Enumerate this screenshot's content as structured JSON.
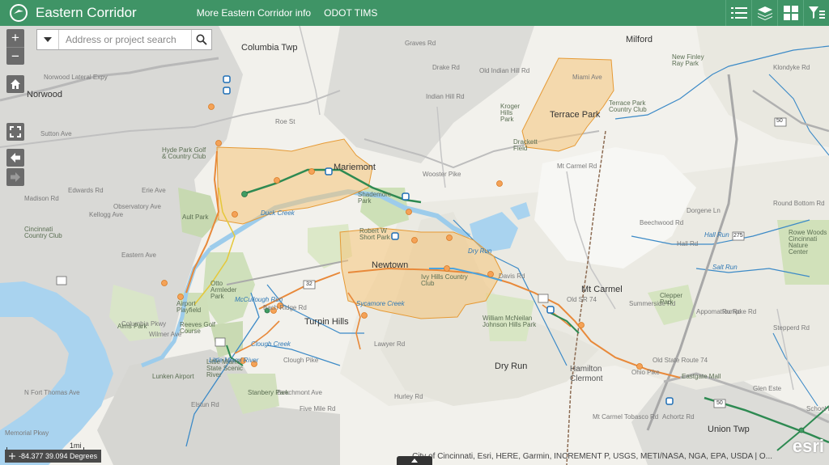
{
  "header": {
    "title": "Eastern Corridor",
    "links": [
      "More Eastern Corridor info",
      "ODOT TIMS"
    ],
    "icons": [
      "list-icon",
      "layers-icon",
      "basemap-gallery-icon",
      "filter-icon"
    ],
    "color": "#3f9466"
  },
  "search": {
    "placeholder": "Address or project search"
  },
  "controls": {
    "zoom_in": "+",
    "zoom_out": "−"
  },
  "coordinates": "-84.377 39.094 Degrees",
  "scale_label": "1mi",
  "attribution": "City of Cincinnati, Esri, HERE, Garmin, INCREMENT P, USGS, METI/NASA, NGA, EPA, USDA | O...",
  "logo_text": "esri",
  "labels": {
    "towns": [
      "Columbia Twp",
      "Norwood",
      "Mariemont",
      "Terrace Park",
      "Newtown",
      "Turpin Hills",
      "Mt Carmel",
      "Dry Run",
      "Union Twp",
      "Milford",
      "Eastgate Mall"
    ],
    "roads": [
      "Norwood Lateral Expy",
      "Roe St",
      "Erie Ave",
      "Observatory Ave",
      "Madison Rd",
      "Edwards Rd",
      "Graves Rd",
      "Indian Hill Rd",
      "Old Indian Hill Rd",
      "Drake Rd",
      "Miami Ave",
      "Wooster Pike",
      "Mt Carmel Rd",
      "Round Bottom Rd",
      "Beechwood Rd",
      "Dorgene Ln",
      "Hall Rd",
      "Ohio Pike",
      "Sutton Ave",
      "Clough Pike",
      "Lawyer Rd",
      "Beechmont Ave",
      "Hurley Rd",
      "Old State Route 74",
      "Summerside Rd",
      "Bach Ridge Rd",
      "Hamilton",
      "Clermont",
      "Wilmer Ave",
      "Eastern Ave",
      "Kellogg Ave",
      "Columbia Pkwy",
      "Elstun Rd",
      "Five Mile Rd",
      "Klondyke Rd",
      "Davis Rd",
      "Old SR 74",
      "Mt Carmel Tobasco Rd",
      "Achortz Rd",
      "Appomattox Rd",
      "Stepperd Rd",
      "Rumpke Rd",
      "Glen Este",
      "N Fort Thomas Ave",
      "Memorial Pkwy",
      "School Rd"
    ],
    "water": [
      "Little Miami River",
      "Duck Creek",
      "Clough Creek",
      "McCullough Run",
      "Dry Run",
      "Sycamore Creek",
      "Salt Run",
      "Hall Run"
    ],
    "parks": [
      "Hyde Park Golf & Country Club",
      "Ault Park",
      "Cincinnati Country Club",
      "Otto Armleder Park",
      "Reeves Golf Course",
      "Airport Playfield",
      "Alms Park",
      "Little Miami State Scenic River",
      "Lunken Airport",
      "Stanbery Park",
      "Shademore Park",
      "Robert W Short Park",
      "Ivy Hills Country Club",
      "William McNeilan Johnson Hills Park",
      "Kroger Hills Park",
      "Drackett Field",
      "Terrace Park Country Club",
      "New Finley Ray Park",
      "Rowe Woods Cincinnati Nature Center",
      "Clepper Park"
    ],
    "numbers": [
      "50",
      "32",
      "275",
      "50"
    ]
  }
}
